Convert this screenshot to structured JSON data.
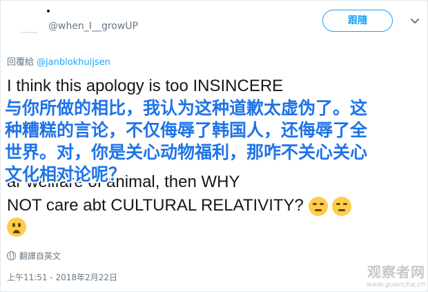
{
  "header": {
    "handle": "@when_I__growUP",
    "follow_label": "跟隨"
  },
  "reply": {
    "label": "回覆給",
    "to": "@janblokhuijsen"
  },
  "tweet_lines": [
    "I think this apology is too INSINCERE",
    "",
    "",
    "",
    "ar                      wellfare of animal, then WHY",
    "NOT care abt CULTURAL RELATIVITY?"
  ],
  "overlay_lines": [
    "与你所做的相比，我认为这种道歉太虚伪了。这",
    "种糟糕的言论，不仅侮辱了韩国人，还侮辱了全",
    "世界。对，你是关心动物福利，那咋不关心关心",
    "文化相对论呢？"
  ],
  "translate_label": "翻譯自英文",
  "timestamp": "上午11:51 - 2018年2月22日",
  "watermark": {
    "main": "观察者网",
    "sub": "www.guancha.cn"
  },
  "emojis": [
    "persevering-face",
    "persevering-face",
    "frowning-face"
  ],
  "colors": {
    "accent": "#1da1f2",
    "overlay_text": "#1e73e8",
    "secondary_text": "#657786"
  }
}
